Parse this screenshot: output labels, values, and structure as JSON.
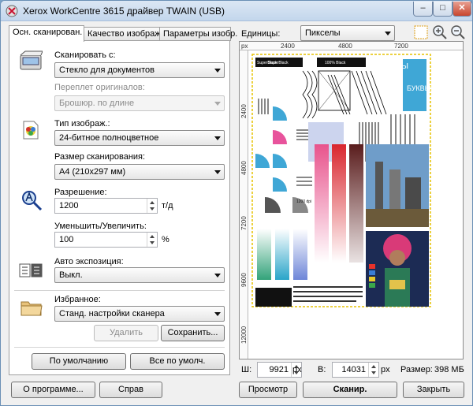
{
  "window": {
    "title": "Xerox WorkCentre 3615 драйвер TWAIN (USB)",
    "buttons": {
      "minimize": "–",
      "maximize": "□",
      "close": "✕"
    }
  },
  "tabs": [
    {
      "label": "Осн. сканирован.",
      "active": true
    },
    {
      "label": "Качество изображ.",
      "active": false
    },
    {
      "label": "Параметры изобр.",
      "active": false
    }
  ],
  "scan_from": {
    "label": "Сканировать с:",
    "value": "Стекло для документов"
  },
  "binding": {
    "label": "Переплет оригиналов:",
    "value": "Брошюр. по длине",
    "disabled": true
  },
  "image_type": {
    "label": "Тип изображ.:",
    "value": "24-битное полноцветное"
  },
  "scan_size": {
    "label": "Размер сканирования:",
    "value": "A4 (210x297 мм)"
  },
  "resolution": {
    "label": "Разрешение:",
    "value": "1200",
    "unit": "т/д"
  },
  "scale": {
    "label": "Уменьшить/Увеличить:",
    "value": "100",
    "unit": "%"
  },
  "auto_exposure": {
    "label": "Авто экспозиция:",
    "value": "Выкл."
  },
  "favorites": {
    "label": "Избранное:",
    "value": "Станд. настройки сканера",
    "delete_label": "Удалить",
    "save_label": "Сохранить..."
  },
  "defaults": {
    "default_label": "По умолчанию",
    "all_default_label": "Все по умолч."
  },
  "units": {
    "label": "Единицы:",
    "value": "Пикселы"
  },
  "ruler": {
    "unit": "px",
    "top_ticks": [
      "2400",
      "4800",
      "7200"
    ],
    "left_ticks": [
      "2400",
      "4800",
      "7200",
      "9600",
      "12000"
    ]
  },
  "preview_sample_text": {
    "superblack": "SuperBlack",
    "superblack2": "SuperBlack",
    "black100": "100% Black",
    "bukvy": "БУКВЫ",
    "bukvy2": "БУКВЫ",
    "res": "1200 dpi"
  },
  "width": {
    "label": "Ш:",
    "value": "9921",
    "unit": "px"
  },
  "height": {
    "label": "В:",
    "value": "14031",
    "unit": "px"
  },
  "size": {
    "label": "Размер:",
    "value": "398 МБ"
  },
  "bottom_buttons": {
    "about": "О программе...",
    "help": "Справ",
    "preview": "Просмотр",
    "scan": "Сканир.",
    "close": "Закрыть"
  },
  "colors": {
    "title_bar": "#c3d6ec",
    "close_button": "#c8452d",
    "preview_border_dash": "#e6c200"
  }
}
